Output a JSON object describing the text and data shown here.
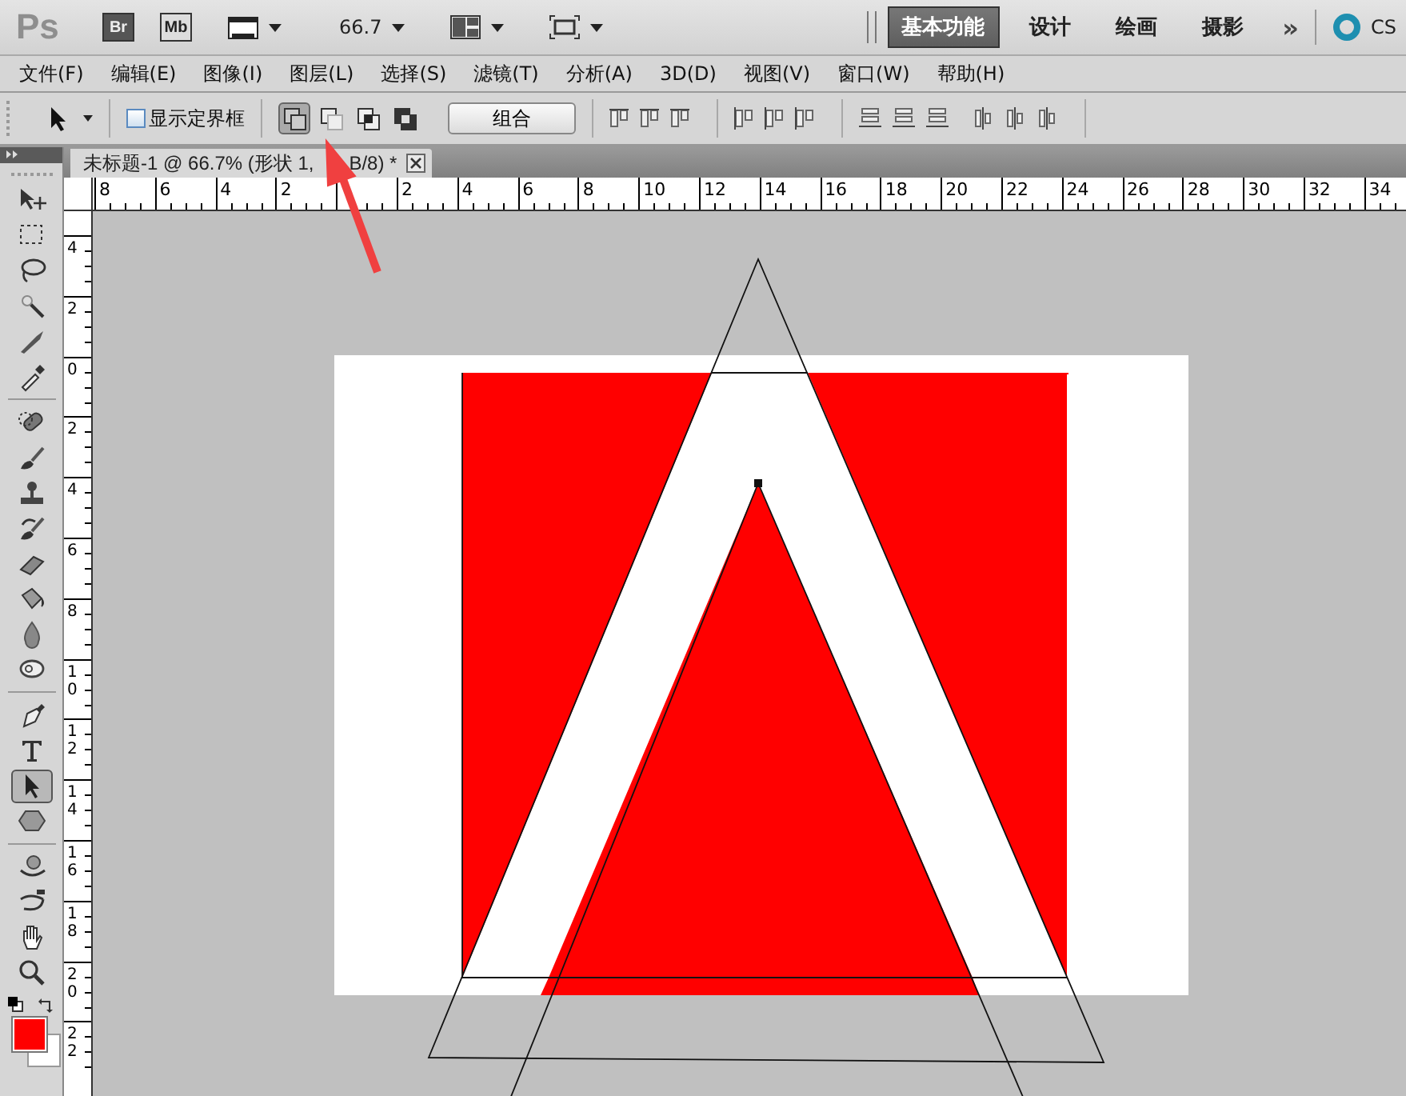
{
  "app_bar": {
    "logo": "Ps",
    "bridge": "Br",
    "mini_bridge": "Mb",
    "zoom": "66.7",
    "workspaces": [
      {
        "label": "基本功能",
        "selected": true
      },
      {
        "label": "设计",
        "selected": false
      },
      {
        "label": "绘画",
        "selected": false
      },
      {
        "label": "摄影",
        "selected": false
      }
    ],
    "more": "»",
    "cs_live": "CS"
  },
  "menu": [
    "文件(F)",
    "编辑(E)",
    "图像(I)",
    "图层(L)",
    "选择(S)",
    "滤镜(T)",
    "分析(A)",
    "3D(D)",
    "视图(V)",
    "窗口(W)",
    "帮助(H)"
  ],
  "options_bar": {
    "show_bounding_box": {
      "label": "显示定界框",
      "checked": false
    },
    "path_modes": [
      {
        "selected": true
      },
      {
        "selected": false
      },
      {
        "selected": false
      },
      {
        "selected": false
      }
    ],
    "combine_button": "组合"
  },
  "document_tab": {
    "title_start": "未标题-1 @ 66.7% (形状 1,",
    "title_end": "B/8) *"
  },
  "rulers": {
    "horizontal_left_of_origin": [
      "8",
      "6",
      "4",
      "2"
    ],
    "horizontal_right_of_origin": [
      "2",
      "4",
      "6",
      "8",
      "10",
      "12",
      "14",
      "16",
      "18",
      "20",
      "22",
      "24",
      "26",
      "28",
      "30",
      "32",
      "34"
    ],
    "vertical": [
      "4",
      "2",
      "0",
      "2",
      "4",
      "6",
      "8",
      "10",
      "12",
      "14",
      "16",
      "18",
      "20",
      "22"
    ]
  },
  "tools": [
    {
      "kind": "move",
      "selected": false
    },
    {
      "kind": "marquee",
      "selected": false
    },
    {
      "kind": "lasso",
      "selected": false
    },
    {
      "kind": "wand",
      "selected": false
    },
    {
      "kind": "crop",
      "selected": false
    },
    {
      "kind": "eyedropper",
      "selected": false
    },
    {
      "kind": "heal",
      "selected": false
    },
    {
      "kind": "brush",
      "selected": false
    },
    {
      "kind": "stamp",
      "selected": false
    },
    {
      "kind": "history",
      "selected": false
    },
    {
      "kind": "eraser",
      "selected": false
    },
    {
      "kind": "bucket",
      "selected": false
    },
    {
      "kind": "blur",
      "selected": false
    },
    {
      "kind": "dodge",
      "selected": false
    },
    {
      "kind": "pen",
      "selected": false
    },
    {
      "kind": "type",
      "selected": false
    },
    {
      "kind": "path-select",
      "selected": true
    },
    {
      "kind": "shape",
      "selected": false
    },
    {
      "kind": "rotate3d",
      "selected": false
    },
    {
      "kind": "orbit3d",
      "selected": false
    },
    {
      "kind": "hand",
      "selected": false
    },
    {
      "kind": "zoom",
      "selected": false
    }
  ]
}
